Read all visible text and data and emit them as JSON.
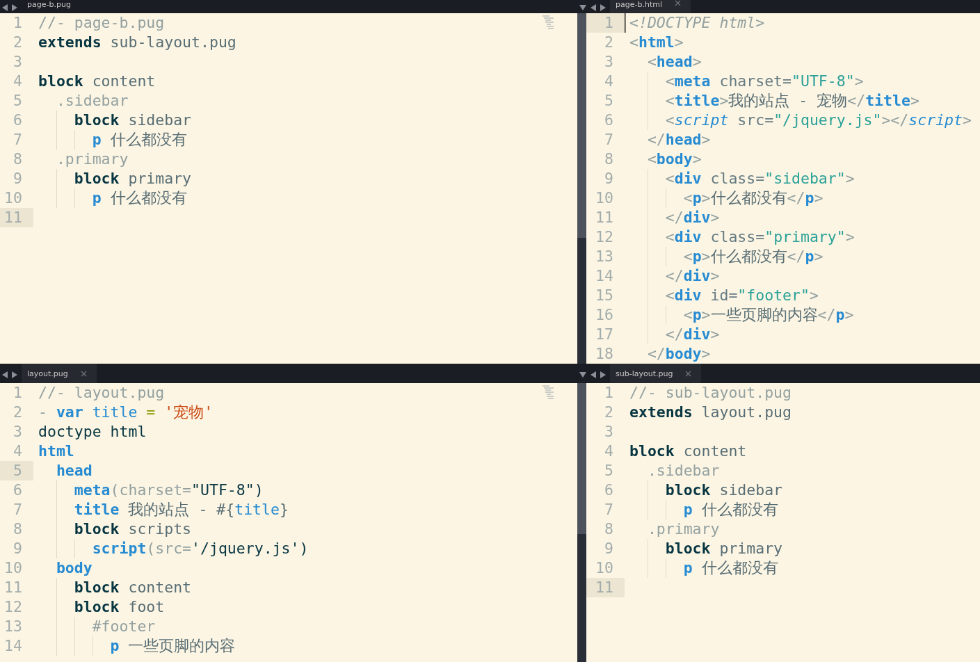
{
  "panes": [
    {
      "tab": {
        "label": "page-b.pug",
        "close": false
      },
      "menu_arrow": false,
      "lines": [
        {
          "number": "1",
          "current": false,
          "tokens": [
            {
              "kind": "comment",
              "text": "//- page-b.pug"
            }
          ]
        },
        {
          "number": "2",
          "current": false,
          "tokens": [
            {
              "kind": "kw",
              "text": "extends"
            },
            {
              "kind": "plain",
              "text": " sub-layout.pug"
            }
          ]
        },
        {
          "number": "3",
          "current": false
        },
        {
          "number": "4",
          "current": false,
          "tokens": [
            {
              "kind": "kw",
              "text": "block"
            },
            {
              "kind": "plain",
              "text": " content"
            }
          ]
        },
        {
          "number": "5",
          "current": false,
          "tokens": [
            {
              "kind": "cls",
              "text": "  .sidebar"
            }
          ]
        },
        {
          "number": "6",
          "current": false,
          "tokens": [
            {
              "kind": "kw",
              "text": "    block"
            },
            {
              "kind": "plain",
              "text": " sidebar"
            }
          ]
        },
        {
          "number": "7",
          "current": false,
          "tokens": [
            {
              "kind": "tag",
              "text": "      p"
            },
            {
              "kind": "plain",
              "text": " 什么都没有"
            }
          ]
        },
        {
          "number": "8",
          "current": false,
          "tokens": [
            {
              "kind": "cls",
              "text": "  .primary"
            }
          ]
        },
        {
          "number": "9",
          "current": false,
          "tokens": [
            {
              "kind": "kw",
              "text": "    block"
            },
            {
              "kind": "plain",
              "text": " primary"
            }
          ]
        },
        {
          "number": "10",
          "current": false,
          "tokens": [
            {
              "kind": "tag",
              "text": "      p"
            },
            {
              "kind": "plain",
              "text": " 什么都没有"
            }
          ]
        },
        {
          "number": "11",
          "current": true
        }
      ]
    },
    {
      "tab": {
        "label": "page-b.html",
        "close": true
      },
      "menu_arrow": true,
      "lines": [
        {
          "number": "1",
          "current": true,
          "cursor": true,
          "tokens": [
            {
              "kind": "doctype",
              "text": "<!DOCTYPE html>"
            }
          ]
        },
        {
          "number": "2",
          "current": false,
          "tokens": [
            {
              "kind": "punct",
              "text": "<"
            },
            {
              "kind": "tag",
              "text": "html"
            },
            {
              "kind": "punct",
              "text": ">"
            }
          ]
        },
        {
          "number": "3",
          "current": false,
          "tokens": [
            {
              "kind": "punct",
              "text": "  <"
            },
            {
              "kind": "tag",
              "text": "head"
            },
            {
              "kind": "punct",
              "text": ">"
            }
          ]
        },
        {
          "number": "4",
          "current": false,
          "tokens": [
            {
              "kind": "punct",
              "text": "    <"
            },
            {
              "kind": "tag",
              "text": "meta"
            },
            {
              "kind": "attr",
              "text": " charset="
            },
            {
              "kind": "str",
              "text": "\"UTF-8\""
            },
            {
              "kind": "punct",
              "text": ">"
            }
          ]
        },
        {
          "number": "5",
          "current": false,
          "tokens": [
            {
              "kind": "punct",
              "text": "    <"
            },
            {
              "kind": "tag",
              "text": "title"
            },
            {
              "kind": "punct",
              "text": ">"
            },
            {
              "kind": "plain",
              "text": "我的站点 - 宠物"
            },
            {
              "kind": "punct",
              "text": "</"
            },
            {
              "kind": "tag",
              "text": "title"
            },
            {
              "kind": "punct",
              "text": ">"
            }
          ]
        },
        {
          "number": "6",
          "current": false,
          "tokens": [
            {
              "kind": "punct",
              "text": "    <"
            },
            {
              "kind": "itag",
              "text": "script"
            },
            {
              "kind": "attr",
              "text": " src="
            },
            {
              "kind": "str",
              "text": "\"/jquery.js\""
            },
            {
              "kind": "punct",
              "text": "></"
            },
            {
              "kind": "itag",
              "text": "script"
            },
            {
              "kind": "punct",
              "text": ">"
            }
          ]
        },
        {
          "number": "7",
          "current": false,
          "tokens": [
            {
              "kind": "punct",
              "text": "  </"
            },
            {
              "kind": "tag",
              "text": "head"
            },
            {
              "kind": "punct",
              "text": ">"
            }
          ]
        },
        {
          "number": "8",
          "current": false,
          "tokens": [
            {
              "kind": "punct",
              "text": "  <"
            },
            {
              "kind": "tag",
              "text": "body"
            },
            {
              "kind": "punct",
              "text": ">"
            }
          ]
        },
        {
          "number": "9",
          "current": false,
          "tokens": [
            {
              "kind": "punct",
              "text": "    <"
            },
            {
              "kind": "tag",
              "text": "div"
            },
            {
              "kind": "attr",
              "text": " class="
            },
            {
              "kind": "str",
              "text": "\"sidebar\""
            },
            {
              "kind": "punct",
              "text": ">"
            }
          ]
        },
        {
          "number": "10",
          "current": false,
          "tokens": [
            {
              "kind": "punct",
              "text": "      <"
            },
            {
              "kind": "tag",
              "text": "p"
            },
            {
              "kind": "punct",
              "text": ">"
            },
            {
              "kind": "plain",
              "text": "什么都没有"
            },
            {
              "kind": "punct",
              "text": "</"
            },
            {
              "kind": "tag",
              "text": "p"
            },
            {
              "kind": "punct",
              "text": ">"
            }
          ]
        },
        {
          "number": "11",
          "current": false,
          "tokens": [
            {
              "kind": "punct",
              "text": "    </"
            },
            {
              "kind": "tag",
              "text": "div"
            },
            {
              "kind": "punct",
              "text": ">"
            }
          ]
        },
        {
          "number": "12",
          "current": false,
          "tokens": [
            {
              "kind": "punct",
              "text": "    <"
            },
            {
              "kind": "tag",
              "text": "div"
            },
            {
              "kind": "attr",
              "text": " class="
            },
            {
              "kind": "str",
              "text": "\"primary\""
            },
            {
              "kind": "punct",
              "text": ">"
            }
          ]
        },
        {
          "number": "13",
          "current": false,
          "tokens": [
            {
              "kind": "punct",
              "text": "      <"
            },
            {
              "kind": "tag",
              "text": "p"
            },
            {
              "kind": "punct",
              "text": ">"
            },
            {
              "kind": "plain",
              "text": "什么都没有"
            },
            {
              "kind": "punct",
              "text": "</"
            },
            {
              "kind": "tag",
              "text": "p"
            },
            {
              "kind": "punct",
              "text": ">"
            }
          ]
        },
        {
          "number": "14",
          "current": false,
          "tokens": [
            {
              "kind": "punct",
              "text": "    </"
            },
            {
              "kind": "tag",
              "text": "div"
            },
            {
              "kind": "punct",
              "text": ">"
            }
          ]
        },
        {
          "number": "15",
          "current": false,
          "tokens": [
            {
              "kind": "punct",
              "text": "    <"
            },
            {
              "kind": "tag",
              "text": "div"
            },
            {
              "kind": "attr",
              "text": " id="
            },
            {
              "kind": "str",
              "text": "\"footer\""
            },
            {
              "kind": "punct",
              "text": ">"
            }
          ]
        },
        {
          "number": "16",
          "current": false,
          "tokens": [
            {
              "kind": "punct",
              "text": "      <"
            },
            {
              "kind": "tag",
              "text": "p"
            },
            {
              "kind": "punct",
              "text": ">"
            },
            {
              "kind": "plain",
              "text": "一些页脚的内容"
            },
            {
              "kind": "punct",
              "text": "</"
            },
            {
              "kind": "tag",
              "text": "p"
            },
            {
              "kind": "punct",
              "text": ">"
            }
          ]
        },
        {
          "number": "17",
          "current": false,
          "tokens": [
            {
              "kind": "punct",
              "text": "    </"
            },
            {
              "kind": "tag",
              "text": "div"
            },
            {
              "kind": "punct",
              "text": ">"
            }
          ]
        },
        {
          "number": "18",
          "current": false,
          "tokens": [
            {
              "kind": "punct",
              "text": "  </"
            },
            {
              "kind": "tag",
              "text": "body"
            },
            {
              "kind": "punct",
              "text": ">"
            }
          ]
        }
      ]
    },
    {
      "tab": {
        "label": "layout.pug",
        "close": true
      },
      "menu_arrow": false,
      "lines": [
        {
          "number": "1",
          "current": false,
          "tokens": [
            {
              "kind": "comment",
              "text": "//- layout.pug"
            }
          ]
        },
        {
          "number": "2",
          "current": false,
          "tokens": [
            {
              "kind": "punct",
              "text": "- "
            },
            {
              "kind": "tag",
              "text": "var"
            },
            {
              "kind": "var",
              "text": " title"
            },
            {
              "kind": "op",
              "text": " = "
            },
            {
              "kind": "str2",
              "text": "'宠物'"
            }
          ]
        },
        {
          "number": "3",
          "current": false,
          "tokens": [
            {
              "kind": "dark",
              "text": "doctype html"
            }
          ]
        },
        {
          "number": "4",
          "current": false,
          "tokens": [
            {
              "kind": "tag",
              "text": "html"
            }
          ]
        },
        {
          "number": "5",
          "current": true,
          "tokens": [
            {
              "kind": "tag",
              "text": "  head"
            }
          ]
        },
        {
          "number": "6",
          "current": false,
          "tokens": [
            {
              "kind": "tag",
              "text": "    meta"
            },
            {
              "kind": "punct",
              "text": "(charset="
            },
            {
              "kind": "dark",
              "text": "\"UTF-8\")"
            }
          ]
        },
        {
          "number": "7",
          "current": false,
          "tokens": [
            {
              "kind": "tag",
              "text": "    title"
            },
            {
              "kind": "plain",
              "text": " 我的站点 - #{"
            },
            {
              "kind": "var",
              "text": "title"
            },
            {
              "kind": "plain",
              "text": "}"
            }
          ]
        },
        {
          "number": "8",
          "current": false,
          "tokens": [
            {
              "kind": "kw",
              "text": "    block"
            },
            {
              "kind": "plain",
              "text": " scripts"
            }
          ]
        },
        {
          "number": "9",
          "current": false,
          "tokens": [
            {
              "kind": "tag",
              "text": "      script"
            },
            {
              "kind": "punct",
              "text": "(src="
            },
            {
              "kind": "dark",
              "text": "'/jquery.js')"
            }
          ]
        },
        {
          "number": "10",
          "current": false,
          "tokens": [
            {
              "kind": "tag",
              "text": "  body"
            }
          ]
        },
        {
          "number": "11",
          "current": false,
          "tokens": [
            {
              "kind": "kw",
              "text": "    block"
            },
            {
              "kind": "plain",
              "text": " content"
            }
          ]
        },
        {
          "number": "12",
          "current": false,
          "tokens": [
            {
              "kind": "kw",
              "text": "    block"
            },
            {
              "kind": "plain",
              "text": " foot"
            }
          ]
        },
        {
          "number": "13",
          "current": false,
          "tokens": [
            {
              "kind": "cls",
              "text": "      #footer"
            }
          ]
        },
        {
          "number": "14",
          "current": false,
          "tokens": [
            {
              "kind": "tag",
              "text": "        p"
            },
            {
              "kind": "plain",
              "text": " 一些页脚的内容"
            }
          ]
        }
      ]
    },
    {
      "tab": {
        "label": "sub-layout.pug",
        "close": true
      },
      "menu_arrow": true,
      "lines": [
        {
          "number": "1",
          "current": false,
          "tokens": [
            {
              "kind": "comment",
              "text": "//- sub-layout.pug"
            }
          ]
        },
        {
          "number": "2",
          "current": false,
          "tokens": [
            {
              "kind": "kw",
              "text": "extends"
            },
            {
              "kind": "plain",
              "text": " layout.pug"
            }
          ]
        },
        {
          "number": "3",
          "current": false
        },
        {
          "number": "4",
          "current": false,
          "tokens": [
            {
              "kind": "kw",
              "text": "block"
            },
            {
              "kind": "plain",
              "text": " content"
            }
          ]
        },
        {
          "number": "5",
          "current": false,
          "tokens": [
            {
              "kind": "cls",
              "text": "  .sidebar"
            }
          ]
        },
        {
          "number": "6",
          "current": false,
          "tokens": [
            {
              "kind": "kw",
              "text": "    block"
            },
            {
              "kind": "plain",
              "text": " sidebar"
            }
          ]
        },
        {
          "number": "7",
          "current": false,
          "tokens": [
            {
              "kind": "tag",
              "text": "      p"
            },
            {
              "kind": "plain",
              "text": " 什么都没有"
            }
          ]
        },
        {
          "number": "8",
          "current": false,
          "tokens": [
            {
              "kind": "cls",
              "text": "  .primary"
            }
          ]
        },
        {
          "number": "9",
          "current": false,
          "tokens": [
            {
              "kind": "kw",
              "text": "    block"
            },
            {
              "kind": "plain",
              "text": " primary"
            }
          ]
        },
        {
          "number": "10",
          "current": false,
          "tokens": [
            {
              "kind": "tag",
              "text": "      p"
            },
            {
              "kind": "plain",
              "text": " 什么都没有"
            }
          ]
        },
        {
          "number": "11",
          "current": true
        }
      ]
    }
  ]
}
